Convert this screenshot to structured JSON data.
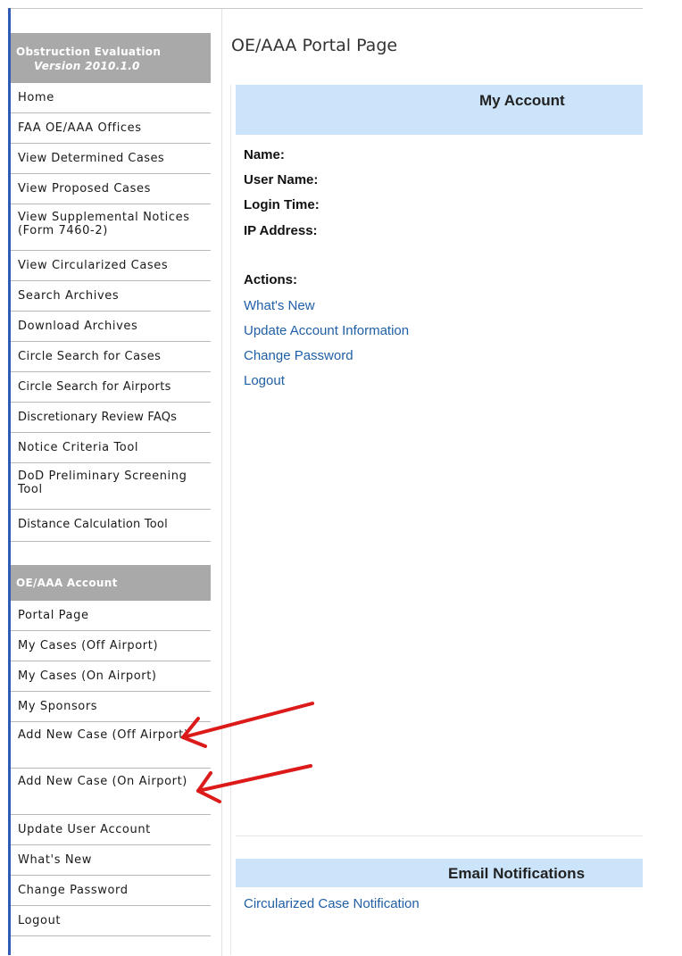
{
  "sidebar": {
    "section1_title_line1": "Obstruction Evaluation",
    "section1_title_line2": "Version 2010.1.0",
    "items": [
      {
        "label": "Home"
      },
      {
        "label": "FAA OE/AAA Offices"
      },
      {
        "label": "View Determined Cases"
      },
      {
        "label": "View Proposed Cases"
      },
      {
        "label": "View Supplemental Notices (Form 7460-2)"
      },
      {
        "label": "View Circularized Cases"
      },
      {
        "label": "Search Archives"
      },
      {
        "label": "Download Archives"
      },
      {
        "label": "Circle Search for Cases"
      },
      {
        "label": "Circle Search for Airports"
      },
      {
        "label": "Discretionary Review FAQs"
      },
      {
        "label": "Notice Criteria Tool"
      },
      {
        "label": "DoD Preliminary Screening Tool"
      },
      {
        "label": "Distance Calculation Tool"
      }
    ],
    "section2_title": "OE/AAA Account",
    "account_items": [
      {
        "label": "Portal Page"
      },
      {
        "label": "My Cases (Off Airport)"
      },
      {
        "label": "My Cases (On Airport)"
      },
      {
        "label": "My Sponsors"
      },
      {
        "label": "Add New Case (Off Airport)"
      },
      {
        "label": "Add New Case (On Airport)"
      },
      {
        "label": "Update User Account"
      },
      {
        "label": "What's New"
      },
      {
        "label": "Change Password"
      },
      {
        "label": "Logout"
      }
    ]
  },
  "main": {
    "title": "OE/AAA Portal Page",
    "my_account_header": "My Account",
    "name_label": "Name:",
    "username_label": "User Name:",
    "login_time_label": "Login Time:",
    "ip_label": "IP Address:",
    "actions_label": "Actions:",
    "actions": [
      {
        "label": "What's New"
      },
      {
        "label": "Update Account Information"
      },
      {
        "label": "Change Password"
      },
      {
        "label": "Logout"
      }
    ],
    "email_header": "Email Notifications",
    "email_link": "Circularized Case Notification"
  },
  "colors": {
    "sidebar_header_bg": "#a9a9a9",
    "section_bar_bg": "#cce4fa",
    "link": "#1f5fa6",
    "annotation_arrow": "#dd1a1a",
    "left_edge": "#2f5bb7"
  }
}
